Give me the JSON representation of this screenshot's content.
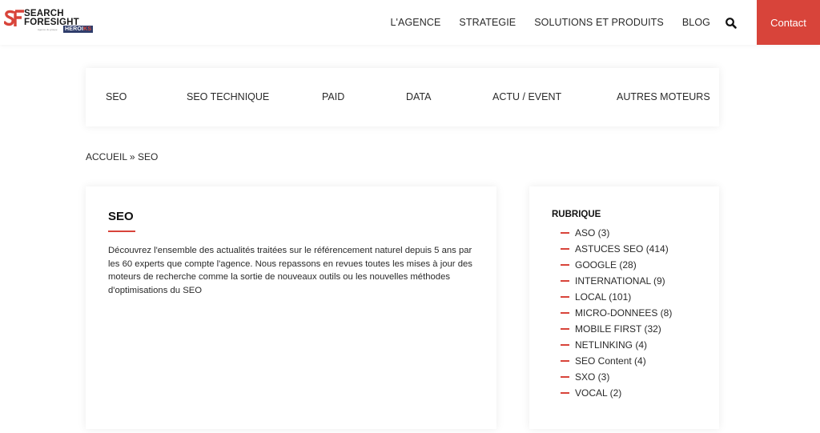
{
  "brand": {
    "name_line1": "SEARCH",
    "name_line2": "FORESIGHT",
    "sub": "Agence du groupe",
    "badge_part1": "HEROI",
    "badge_part2": "KS",
    "accent_color": "#d8443a"
  },
  "nav": {
    "items": [
      {
        "label": "L'AGENCE"
      },
      {
        "label": "STRATEGIE"
      },
      {
        "label": "SOLUTIONS ET PRODUITS"
      },
      {
        "label": "BLOG"
      }
    ],
    "search_icon": "search-icon",
    "contact_label": "Contact"
  },
  "categories": [
    {
      "label": "SEO"
    },
    {
      "label": "SEO TECHNIQUE"
    },
    {
      "label": "PAID"
    },
    {
      "label": "DATA"
    },
    {
      "label": "ACTU / EVENT"
    },
    {
      "label": "AUTRES MOTEURS"
    }
  ],
  "breadcrumb": {
    "home": "ACCUEIL",
    "separator": "»",
    "current": "SEO"
  },
  "main": {
    "title": "SEO",
    "description": "Découvrez l'ensemble des actualités traitées sur le référencement naturel depuis 5 ans par les 60 experts que compte l'agence. Nous repassons en revues toutes les mises à jour des moteurs de recherche comme la sortie de nouveaux outils ou les nouvelles méthodes d'optimisations du SEO"
  },
  "sidebar": {
    "title": "RUBRIQUE",
    "items": [
      {
        "label": "ASO (3)"
      },
      {
        "label": "ASTUCES SEO (414)"
      },
      {
        "label": "GOOGLE (28)"
      },
      {
        "label": "INTERNATIONAL (9)"
      },
      {
        "label": "LOCAL (101)"
      },
      {
        "label": "MICRO-DONNEES (8)"
      },
      {
        "label": "MOBILE FIRST (32)"
      },
      {
        "label": "NETLINKING (4)"
      },
      {
        "label": "SEO Content (4)"
      },
      {
        "label": "SXO (3)"
      },
      {
        "label": "VOCAL (2)"
      }
    ]
  }
}
